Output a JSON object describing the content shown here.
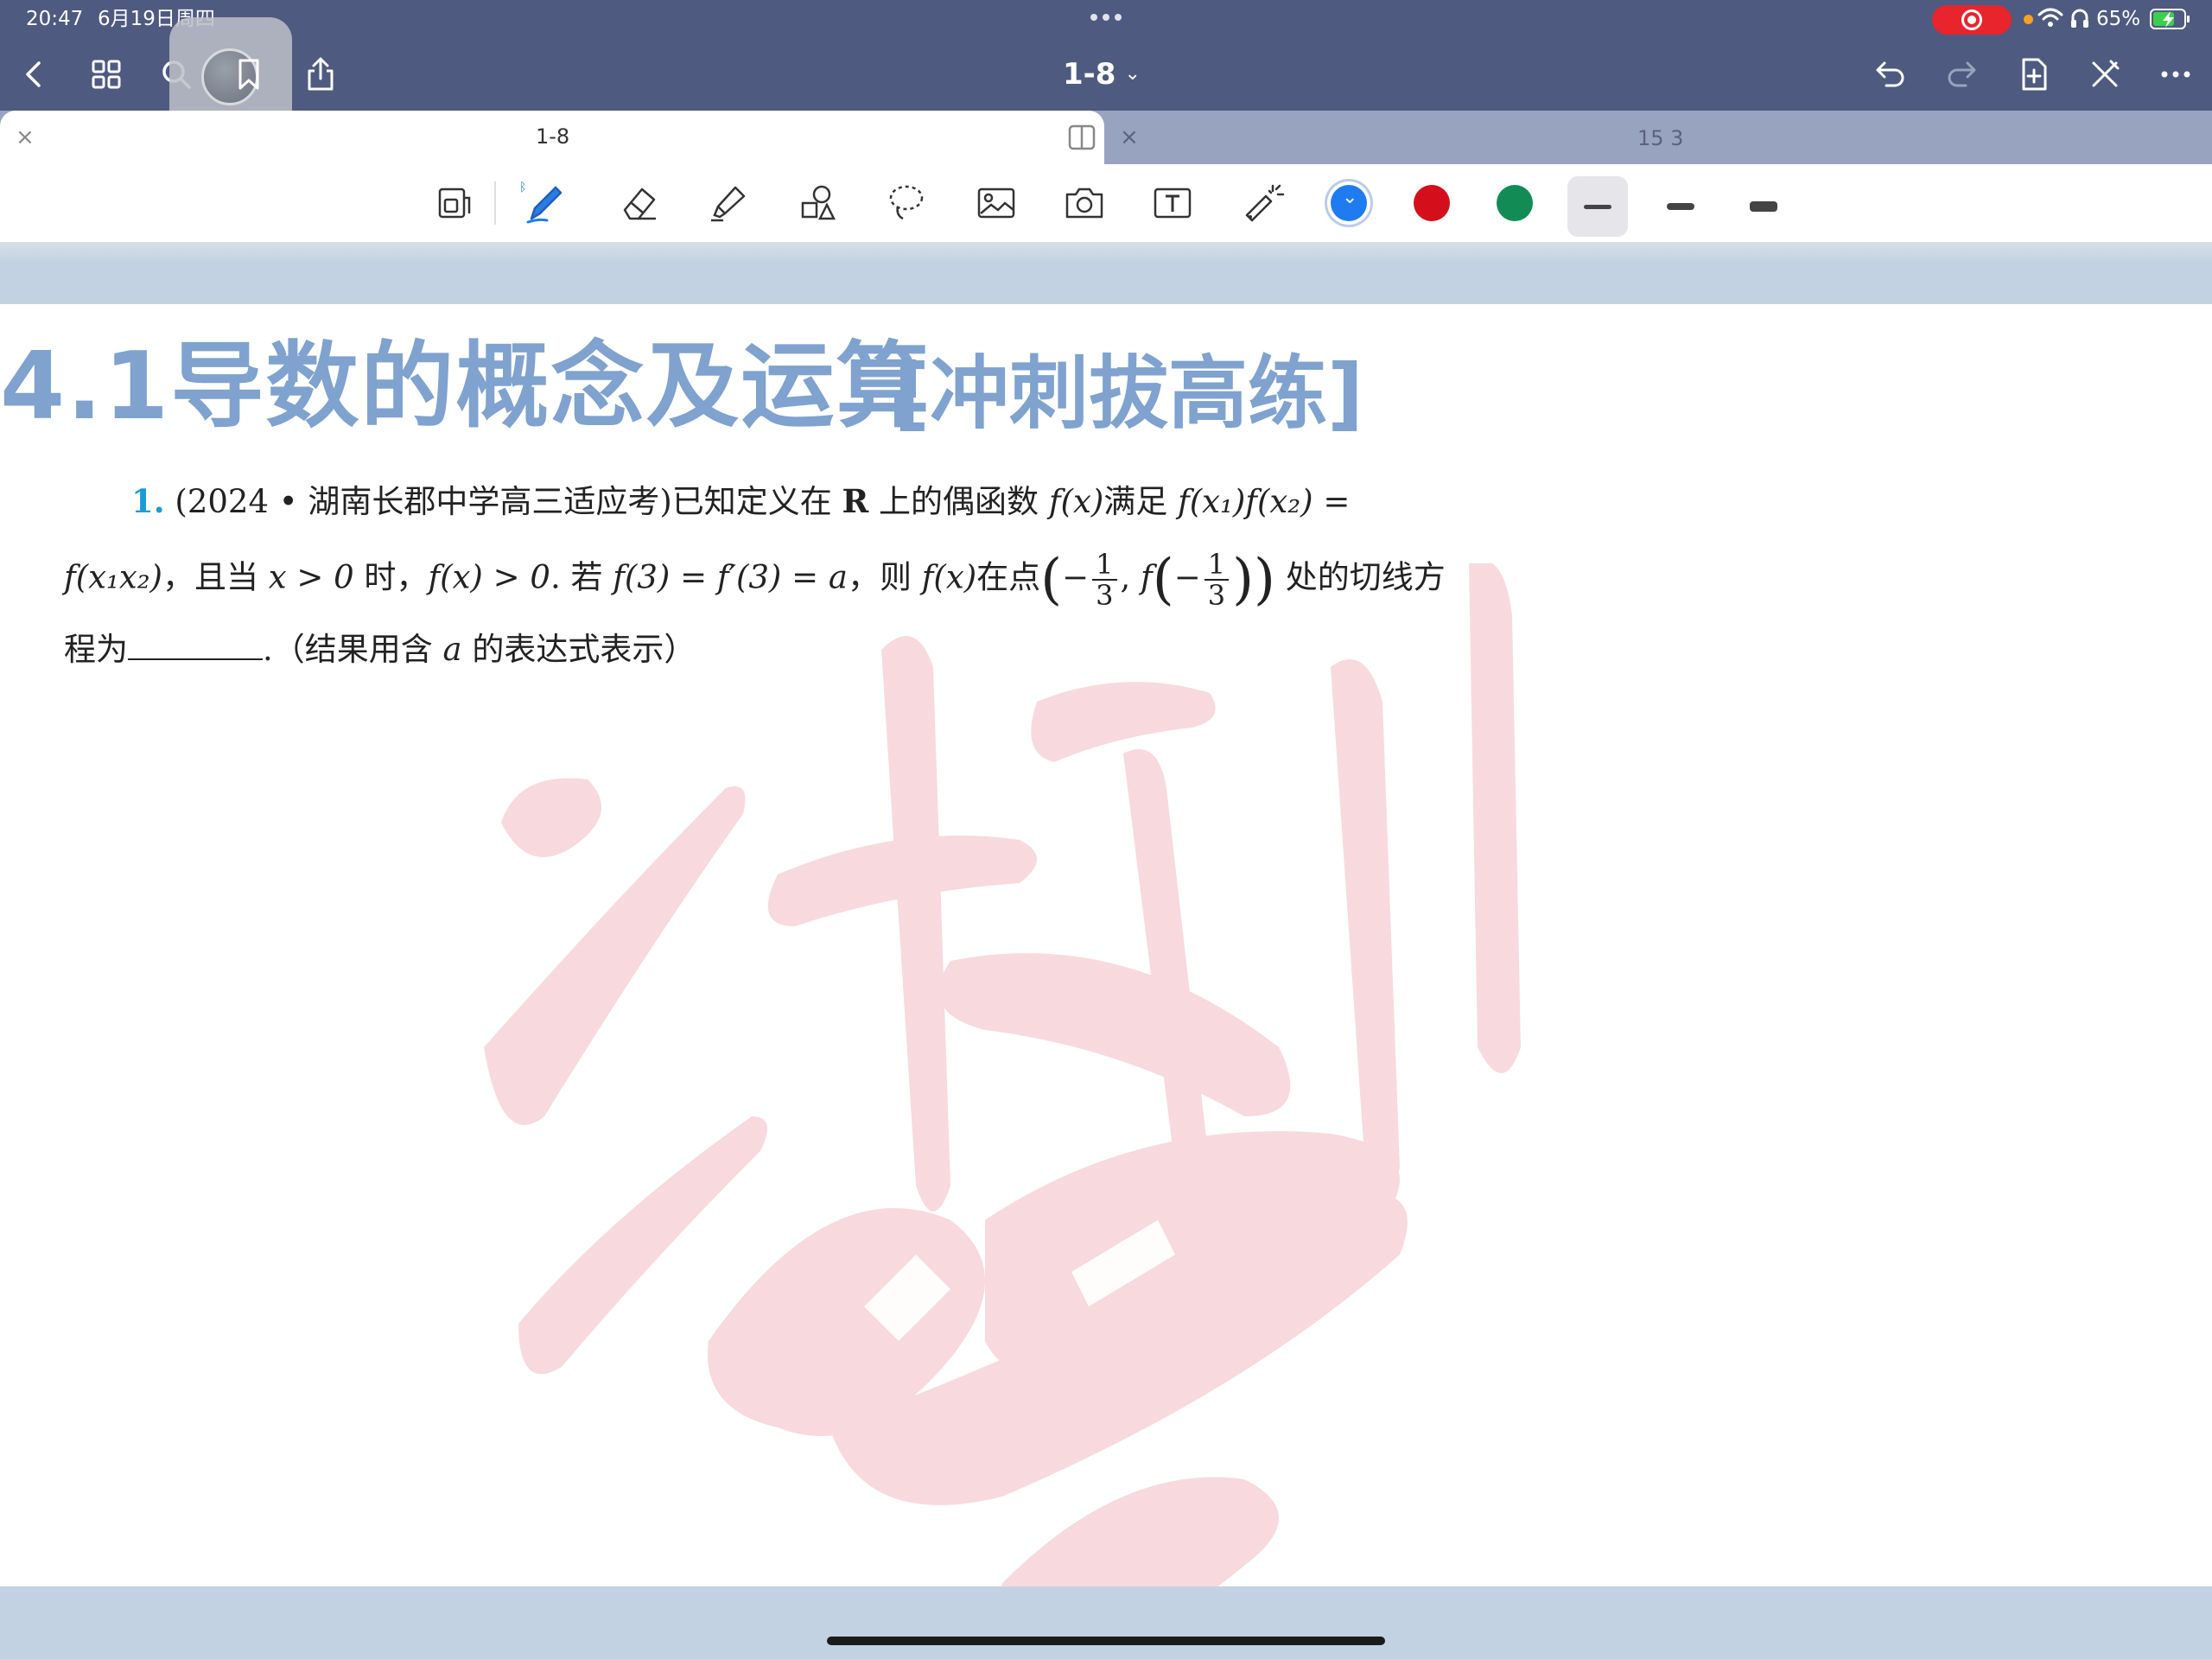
{
  "status_bar": {
    "time": "20:47",
    "date": "6月19日周四",
    "battery": "65%"
  },
  "nav": {
    "back_icon": "chevron-left-icon",
    "grid_icon": "grid-icon",
    "search_icon": "search-icon",
    "bookmark_icon": "bookmark-icon",
    "share_icon": "share-icon",
    "title": "1-8",
    "title_chevron": "⌄",
    "undo_icon": "undo-icon",
    "redo_icon": "redo-icon",
    "add_page_icon": "add-page-icon",
    "close_edit_icon": "close-edit-icon",
    "more_icon": "more-icon"
  },
  "tabs": [
    {
      "label": "1-8",
      "close": "×",
      "active": true
    },
    {
      "label": "15 3",
      "close": "×",
      "active": false
    }
  ],
  "toolbar": {
    "tools": [
      "page-layout",
      "pen",
      "eraser",
      "highlighter",
      "shapes",
      "lasso",
      "image",
      "camera",
      "text",
      "laser-pointer"
    ],
    "colors": {
      "blue": "#1f7cf0",
      "red": "#d40f1b",
      "green": "#128c54"
    },
    "stroke_sizes": [
      "thin",
      "medium",
      "thick"
    ]
  },
  "document": {
    "heading": "4.1导数的概念及运算",
    "subheading": "[冲刺拔高练]",
    "accent_color": "#7fa2cf",
    "question": {
      "number": "1.",
      "line1_a": "(2024 • 湖南长郡中学高三适应考)已知定义在 ",
      "line1_R": "R",
      "line1_b": " 上的偶函数 ",
      "line1_c": "f(x)",
      "line1_d": "满足 ",
      "line1_e": "f(x₁)f(x₂) =",
      "line2_a": "f(x₁x₂)",
      "line2_b": "，且当 ",
      "line2_c": "x > 0",
      "line2_d": " 时，",
      "line2_e": "f(x) > 0",
      "line2_f": ". 若 ",
      "line2_g": "f(3) = f′(3) = a",
      "line2_h": "，则 ",
      "line2_i": "f(x)",
      "line2_j": "在点",
      "line2_neg": "−",
      "frac_num": "1",
      "frac_den": "3",
      "line2_f2": "f",
      "line2_k": " 处的切线方",
      "line3_a": "程为",
      "line3_b": ".（结果用含 ",
      "line3_c": "a",
      "line3_d": " 的表达式表示）"
    }
  }
}
